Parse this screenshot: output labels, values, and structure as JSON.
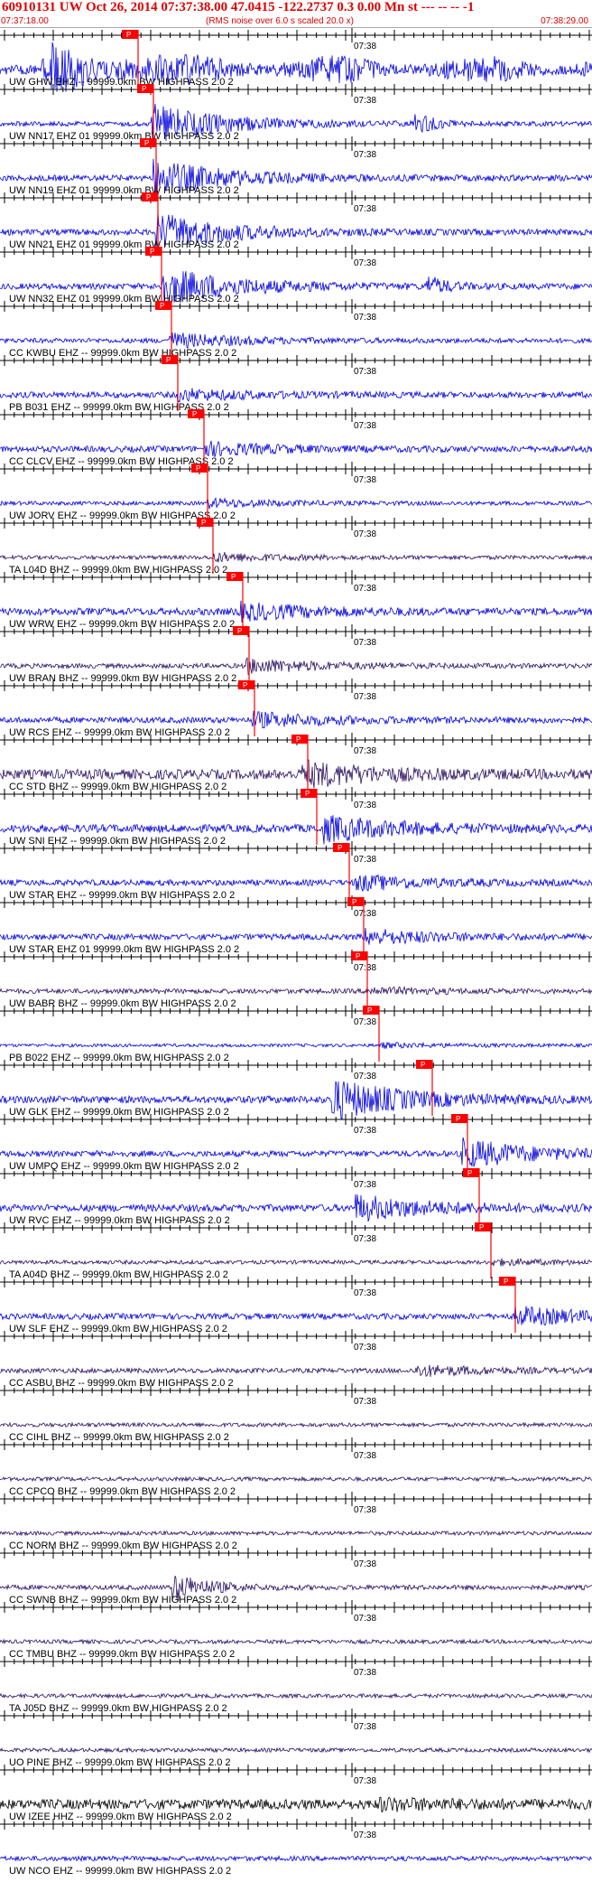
{
  "header": {
    "title": "60910131 UW Oct 26, 2014 07:37:38.00   47.0415 -122.2737  0.3 0.00 Mn st --- -- --  -1",
    "start_time": "07:37:18.00",
    "noise_note": "(RMS noise over 6.0 s scaled 20.0 x)",
    "end_time": "07:38:29.00"
  },
  "minute_label": "07:38",
  "pick_label": "P",
  "colors": {
    "header_text": "#e00000",
    "pick": "#ff0000",
    "trace_blue": "#0000e0",
    "trace_dark": "#2a1060",
    "trace_black": "#000000",
    "axis": "#000000",
    "label": "#000000"
  },
  "traces": [
    {
      "label": "UW GHW EHZ -- 99999.0km BW  HIGHPASS  2.0  2",
      "color": "blue",
      "pick": 0.233,
      "onset": 0.085,
      "amp": 0.75,
      "noise": 0.25,
      "wide": true
    },
    {
      "label": "UW NN17 EHZ 01 99999.0km BW  HIGHPASS  2.0  2",
      "color": "blue",
      "pick": 0.259,
      "onset": 0.255,
      "amp": 0.95,
      "noise": 0.12,
      "burst2": 0.7
    },
    {
      "label": "UW NN19 EHZ 01 99999.0km BW  HIGHPASS  2.0  2",
      "color": "blue",
      "pick": 0.263,
      "onset": 0.258,
      "amp": 0.9,
      "noise": 0.15
    },
    {
      "label": "UW NN21 EHZ 01 99999.0km BW  HIGHPASS  2.0  2",
      "color": "blue",
      "pick": 0.267,
      "onset": 0.263,
      "amp": 0.9,
      "noise": 0.15
    },
    {
      "label": "UW NN32 EHZ 01 99999.0km BW  HIGHPASS  2.0  2",
      "color": "blue",
      "pick": 0.273,
      "onset": 0.27,
      "amp": 0.95,
      "noise": 0.15,
      "burst2": 0.72
    },
    {
      "label": "CC KWBU EHZ -- 99999.0km BW  HIGHPASS  2.0  2",
      "color": "blue",
      "pick": 0.29,
      "onset": 0.285,
      "amp": 0.35,
      "noise": 0.12
    },
    {
      "label": "PB B031 EHZ -- 99999.0km BW  HIGHPASS  2.0  2",
      "color": "blue",
      "pick": 0.3,
      "onset": 0.3,
      "amp": 0.25,
      "noise": 0.15
    },
    {
      "label": "CC CLCV EHZ -- 99999.0km BW  HIGHPASS  2.0  2",
      "color": "blue",
      "pick": 0.345,
      "onset": 0.345,
      "amp": 0.3,
      "noise": 0.15
    },
    {
      "label": "UW JORV EHZ -- 99999.0km BW  HIGHPASS  2.0  2",
      "color": "blue",
      "pick": 0.35,
      "onset": 0.35,
      "amp": 0.2,
      "noise": 0.1
    },
    {
      "label": "TA L04D BHZ -- 99999.0km BW  HIGHPASS  2.0  2",
      "color": "dark",
      "pick": 0.36,
      "onset": 0.36,
      "amp": 0.2,
      "noise": 0.1
    },
    {
      "label": "UW WRW EHZ -- 99999.0km BW  HIGHPASS  2.0  2",
      "color": "blue",
      "pick": 0.41,
      "onset": 0.4,
      "amp": 0.4,
      "noise": 0.18
    },
    {
      "label": "UW BRAN BHZ -- 99999.0km BW  HIGHPASS  2.0  2",
      "color": "dark",
      "pick": 0.42,
      "onset": 0.415,
      "amp": 0.35,
      "noise": 0.12
    },
    {
      "label": "UW RCS EHZ -- 99999.0km BW  HIGHPASS  2.0  2",
      "color": "blue",
      "pick": 0.43,
      "onset": 0.425,
      "amp": 0.35,
      "noise": 0.15
    },
    {
      "label": "CC STD BHZ -- 99999.0km BW  HIGHPASS  2.0  2",
      "color": "dark",
      "pick": 0.52,
      "onset": 0.51,
      "amp": 0.55,
      "noise": 0.25
    },
    {
      "label": "UW SNI EHZ -- 99999.0km BW  HIGHPASS  2.0  2",
      "color": "blue",
      "pick": 0.535,
      "onset": 0.545,
      "amp": 0.6,
      "noise": 0.2
    },
    {
      "label": "UW STAR EHZ -- 99999.0km BW  HIGHPASS  2.0  2",
      "color": "blue",
      "pick": 0.59,
      "onset": 0.6,
      "amp": 0.35,
      "noise": 0.15
    },
    {
      "label": "UW STAR EHZ 01 99999.0km BW  HIGHPASS  2.0  2",
      "color": "blue",
      "pick": 0.615,
      "onset": 0.615,
      "amp": 0.35,
      "noise": 0.15
    },
    {
      "label": "UW BABR BHZ -- 99999.0km BW  HIGHPASS  2.0  2",
      "color": "dark",
      "pick": 0.62,
      "onset": 0.62,
      "amp": 0.15,
      "noise": 0.12
    },
    {
      "label": "PB B022 EHZ -- 99999.0km BW  HIGHPASS  2.0  2",
      "color": "blue",
      "pick": 0.64,
      "onset": 0.64,
      "amp": 0.1,
      "noise": 0.08
    },
    {
      "label": "UW GLK EHZ -- 99999.0km BW  HIGHPASS  2.0  2",
      "color": "blue",
      "pick": 0.73,
      "onset": 0.56,
      "amp": 1.0,
      "noise": 0.18
    },
    {
      "label": "UW UMPQ EHZ -- 99999.0km BW  HIGHPASS  2.0  2",
      "color": "blue",
      "pick": 0.79,
      "onset": 0.78,
      "amp": 0.7,
      "noise": 0.15
    },
    {
      "label": "UW RVC EHZ -- 99999.0km BW  HIGHPASS  2.0  2",
      "color": "blue",
      "pick": 0.81,
      "onset": 0.6,
      "amp": 0.6,
      "noise": 0.18
    },
    {
      "label": "TA A04D BHZ -- 99999.0km BW  HIGHPASS  2.0  2",
      "color": "dark",
      "pick": 0.83,
      "onset": 0.83,
      "amp": 0.12,
      "noise": 0.1
    },
    {
      "label": "UW SLF EHZ -- 99999.0km BW  HIGHPASS  2.0  2",
      "color": "blue",
      "pick": 0.87,
      "onset": 0.87,
      "amp": 0.45,
      "noise": 0.15
    },
    {
      "label": "CC ASBU BHZ -- 99999.0km BW  HIGHPASS  2.0  2",
      "color": "dark",
      "pick": null,
      "onset": 0.7,
      "amp": 0.25,
      "noise": 0.12
    },
    {
      "label": "CC CIHL BHZ -- 99999.0km BW  HIGHPASS  2.0  2",
      "color": "dark",
      "pick": null,
      "onset": null,
      "amp": 0,
      "noise": 0.1
    },
    {
      "label": "CC CPCO BHZ -- 99999.0km BW  HIGHPASS  2.0  2",
      "color": "dark",
      "pick": null,
      "onset": null,
      "amp": 0,
      "noise": 0.1
    },
    {
      "label": "CC NORM BHZ -- 99999.0km BW  HIGHPASS  2.0  2",
      "color": "dark",
      "pick": null,
      "onset": null,
      "amp": 0,
      "noise": 0.1
    },
    {
      "label": "CC SWNB BHZ -- 99999.0km BW  HIGHPASS  2.0  2",
      "color": "dark",
      "pick": null,
      "onset": 0.29,
      "amp": 0.7,
      "noise": 0.12,
      "short": true
    },
    {
      "label": "CC TMBU BHZ -- 99999.0km BW  HIGHPASS  2.0  2",
      "color": "dark",
      "pick": null,
      "onset": null,
      "amp": 0,
      "noise": 0.1
    },
    {
      "label": "TA J05D BHZ -- 99999.0km BW  HIGHPASS  2.0  2",
      "color": "dark",
      "pick": null,
      "onset": null,
      "amp": 0,
      "noise": 0.1
    },
    {
      "label": "UO PINE BHZ -- 99999.0km BW  HIGHPASS  2.0  2",
      "color": "dark",
      "pick": null,
      "onset": null,
      "amp": 0,
      "noise": 0.1
    },
    {
      "label": "UW IZEE HHZ -- 99999.0km BW  HIGHPASS  2.0  2",
      "color": "black",
      "pick": null,
      "onset": 0.64,
      "amp": 0.2,
      "noise": 0.25
    },
    {
      "label": "UW NCO EHZ -- 99999.0km BW  HIGHPASS  2.0  2",
      "color": "blue",
      "pick": null,
      "onset": null,
      "amp": 0,
      "noise": 0.12
    }
  ]
}
